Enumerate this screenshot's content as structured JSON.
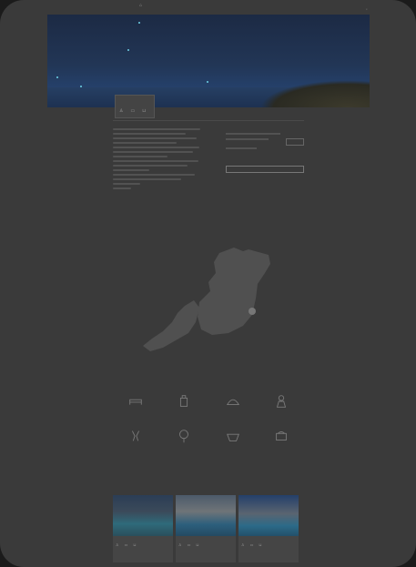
{
  "header": {
    "logo_text": "",
    "links": [
      "",
      "",
      ""
    ]
  },
  "hero": {
    "caption": ""
  },
  "booking": {
    "title": ""
  },
  "nav_tabs": [
    "",
    "",
    "",
    "",
    ""
  ],
  "sidebar": {
    "button_label": "",
    "cta_label": ""
  },
  "map": {
    "title": ""
  },
  "amenities": {
    "heading": "",
    "subheading": "",
    "items": [
      {
        "icon": "bed-icon",
        "label": ""
      },
      {
        "icon": "bag-icon",
        "label": ""
      },
      {
        "icon": "cloche-icon",
        "label": ""
      },
      {
        "icon": "chef-icon",
        "label": ""
      },
      {
        "icon": "champagne-icon",
        "label": ""
      },
      {
        "icon": "tree-icon",
        "label": ""
      },
      {
        "icon": "basket-icon",
        "label": ""
      },
      {
        "icon": "towels-icon",
        "label": ""
      }
    ]
  },
  "similar": {
    "heading": "",
    "cards": [
      {
        "name": "",
        "price": ""
      },
      {
        "name": "",
        "price": ""
      },
      {
        "name": "",
        "price": ""
      }
    ]
  },
  "colors": {
    "background": "#3a3a3a",
    "accent": "#6fd4e8",
    "overlay": "#1b1b1b"
  }
}
